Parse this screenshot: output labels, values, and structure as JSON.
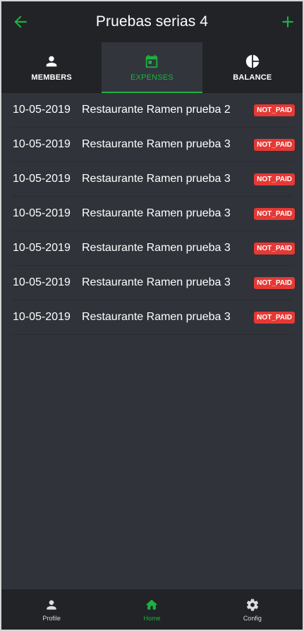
{
  "colors": {
    "accent": "#1db141",
    "background": "#30333a",
    "header": "#212327",
    "badge": "#e53935"
  },
  "header": {
    "title": "Pruebas serias 4",
    "back_icon": "arrow-left-icon",
    "add_icon": "plus-icon"
  },
  "tabs": [
    {
      "label": "MEMBERS",
      "icon": "person-icon",
      "active": false
    },
    {
      "label": "EXPENSES",
      "icon": "calendar-icon",
      "active": true
    },
    {
      "label": "BALANCE",
      "icon": "pie-chart-icon",
      "active": false
    }
  ],
  "expenses": [
    {
      "date": "10-05-2019",
      "description": "Restaurante Ramen prueba 2",
      "status": "NOT_PAID"
    },
    {
      "date": "10-05-2019",
      "description": "Restaurante Ramen prueba 3",
      "status": "NOT_PAID"
    },
    {
      "date": "10-05-2019",
      "description": "Restaurante Ramen prueba 3",
      "status": "NOT_PAID"
    },
    {
      "date": "10-05-2019",
      "description": "Restaurante Ramen prueba 3",
      "status": "NOT_PAID"
    },
    {
      "date": "10-05-2019",
      "description": "Restaurante Ramen prueba 3",
      "status": "NOT_PAID"
    },
    {
      "date": "10-05-2019",
      "description": "Restaurante Ramen prueba 3",
      "status": "NOT_PAID"
    },
    {
      "date": "10-05-2019",
      "description": "Restaurante Ramen prueba 3",
      "status": "NOT_PAID"
    }
  ],
  "bottom_nav": [
    {
      "label": "Profile",
      "icon": "person-icon",
      "active": false
    },
    {
      "label": "Home",
      "icon": "home-icon",
      "active": true
    },
    {
      "label": "Config",
      "icon": "gear-icon",
      "active": false
    }
  ]
}
